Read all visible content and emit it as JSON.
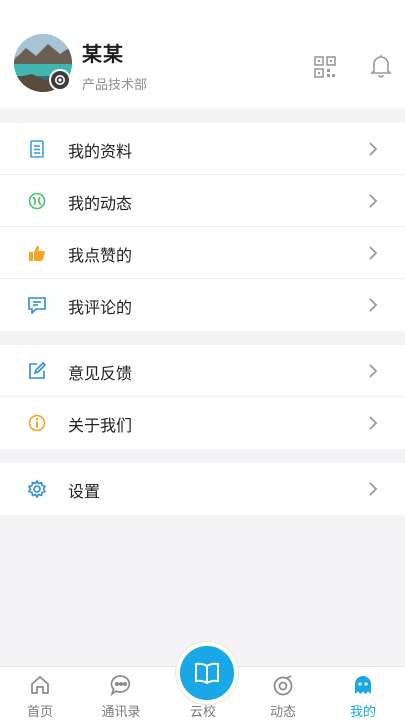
{
  "profile": {
    "name": "某某",
    "department": "产品技术部"
  },
  "menu": {
    "group1": [
      {
        "label": "我的资料",
        "icon": "profile-doc-icon",
        "color": "#3aa0e6"
      },
      {
        "label": "我的动态",
        "icon": "activity-icon",
        "color": "#4cc36b"
      },
      {
        "label": "我点赞的",
        "icon": "thumbs-up-icon",
        "color": "#f5a623"
      },
      {
        "label": "我评论的",
        "icon": "comment-icon",
        "color": "#2e8fd8"
      }
    ],
    "group2": [
      {
        "label": "意见反馈",
        "icon": "edit-icon",
        "color": "#2e8fd8"
      },
      {
        "label": "关于我们",
        "icon": "info-icon",
        "color": "#f5a623"
      }
    ],
    "group3": [
      {
        "label": "设置",
        "icon": "gear-icon",
        "color": "#2e8fd8"
      }
    ]
  },
  "tabbar": {
    "tabs": [
      {
        "label": "首页",
        "icon": "home-icon"
      },
      {
        "label": "通讯录",
        "icon": "chat-icon"
      },
      {
        "label": "云校",
        "icon": "book-icon"
      },
      {
        "label": "动态",
        "icon": "target-icon"
      },
      {
        "label": "我的",
        "icon": "ghost-icon"
      }
    ],
    "active": "我的",
    "accent": "#19a7e8"
  }
}
